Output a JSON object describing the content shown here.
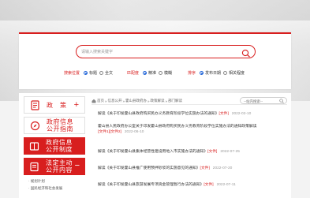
{
  "search": {
    "placeholder": "请输入搜索关键字"
  },
  "filters": {
    "position": {
      "label": "搜索位置",
      "options": [
        "标题",
        "全文"
      ],
      "selected": "标题"
    },
    "match": {
      "label": "匹配度",
      "options": [
        "精准",
        "模糊"
      ],
      "selected": "精准"
    },
    "order": {
      "label": "排序",
      "options": [
        "发布日期",
        "相关程度"
      ],
      "selected": "发布日期"
    }
  },
  "sidebar": {
    "items": [
      {
        "label": "政　策",
        "style": "light",
        "icon": "document-icon",
        "label2": ""
      },
      {
        "label": "政府信息",
        "label2": "公开指南",
        "style": "light",
        "icon": "compass-icon"
      },
      {
        "label": "政府信息",
        "label2": "公开制度",
        "style": "red",
        "icon": "book-icon"
      },
      {
        "label": "法定主动",
        "label2": "公开内容",
        "style": "red",
        "icon": "list-icon"
      }
    ],
    "sub_items": [
      "· 规划计划",
      "· 国民经济和社会发展"
    ]
  },
  "breadcrumb": {
    "items": [
      "首页",
      "信息公开",
      "霍山县政府办",
      "政策解读",
      "部门解读"
    ],
    "separator": "»"
  },
  "inner_search": {
    "placeholder": "--站内搜索--"
  },
  "documents": [
    {
      "text": "解读《关于印发霍山县政府购买民办义务教育阶段学位实施办法的通知》",
      "tag": "[文件]",
      "date": "2022-02-10"
    },
    {
      "text": "霍山县人民政府办公室关于印发霍山县政府购买民办义务教育阶段学位实施办法的通知政策解读",
      "tag": "[文件1]",
      "tag2": "[文件2]",
      "date": "2022-06-10"
    },
    {
      "text": "解读《关于印发霍山县集体经营性建设用地入市实施办法的通知》",
      "tag": "[文件]",
      "date": "2022-07-25"
    },
    {
      "text": "解读《关于印发霍山县推广使用预拌砂浆的实施意见的通知》",
      "tag": "[文件]",
      "date": "2022-07-20"
    },
    {
      "text": "解读《关于印发霍山县旅游发展专项资金管理暂行办法的通知》",
      "tag": "[文件]",
      "date": "2022-07-11"
    }
  ],
  "colors": {
    "accent": "#d81e1e",
    "radio": "#1e63d8"
  }
}
